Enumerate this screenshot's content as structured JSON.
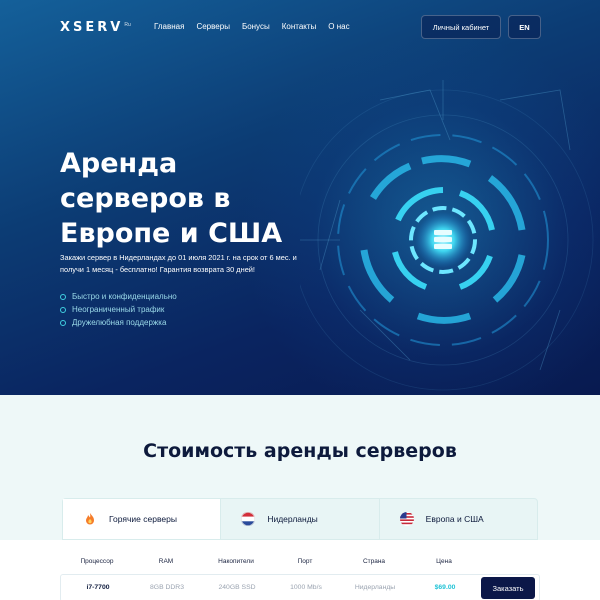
{
  "brand": {
    "logo_text": "XSERV",
    "logo_sup": "Ru"
  },
  "nav": {
    "items": [
      {
        "label": "Главная"
      },
      {
        "label": "Серверы"
      },
      {
        "label": "Бонусы"
      },
      {
        "label": "Контакты"
      },
      {
        "label": "О нас"
      }
    ],
    "cabinet_label": "Личный кабинет",
    "lang_label": "EN"
  },
  "hero": {
    "title": "Аренда серверов в Европе и США",
    "subtitle": "Закажи сервер в Нидерландах до 01 июля 2021 г. на срок от 6 мес. и получи 1 месяц - бесплатно! Гарантия возврата 30 дней!",
    "features": [
      "Быстро и конфиденциально",
      "Неограниченный трафик",
      "Дружелюбная поддержка"
    ]
  },
  "pricing": {
    "title": "Стоимость аренды серверов",
    "tabs": [
      {
        "label": "Горячие серверы",
        "icon": "fire-icon",
        "active": true
      },
      {
        "label": "Нидерланды",
        "icon": "netherlands-flag-icon",
        "active": false
      },
      {
        "label": "Европа и США",
        "icon": "europe-usa-flag-icon",
        "active": false
      }
    ],
    "columns": [
      "Процессор",
      "RAM",
      "Накопители",
      "Порт",
      "Страна",
      "Цена"
    ],
    "rows": [
      {
        "cpu": "i7-7700",
        "ram": "8GB DDR3",
        "storage": "240GB SSD",
        "port": "1000 Mb/s",
        "country": "Нидерланды",
        "price": "$69.00",
        "action": "Заказать"
      }
    ]
  },
  "colors": {
    "accent": "#20c3d6",
    "dark": "#0b1748",
    "hero_bg": "#0c3c74"
  }
}
